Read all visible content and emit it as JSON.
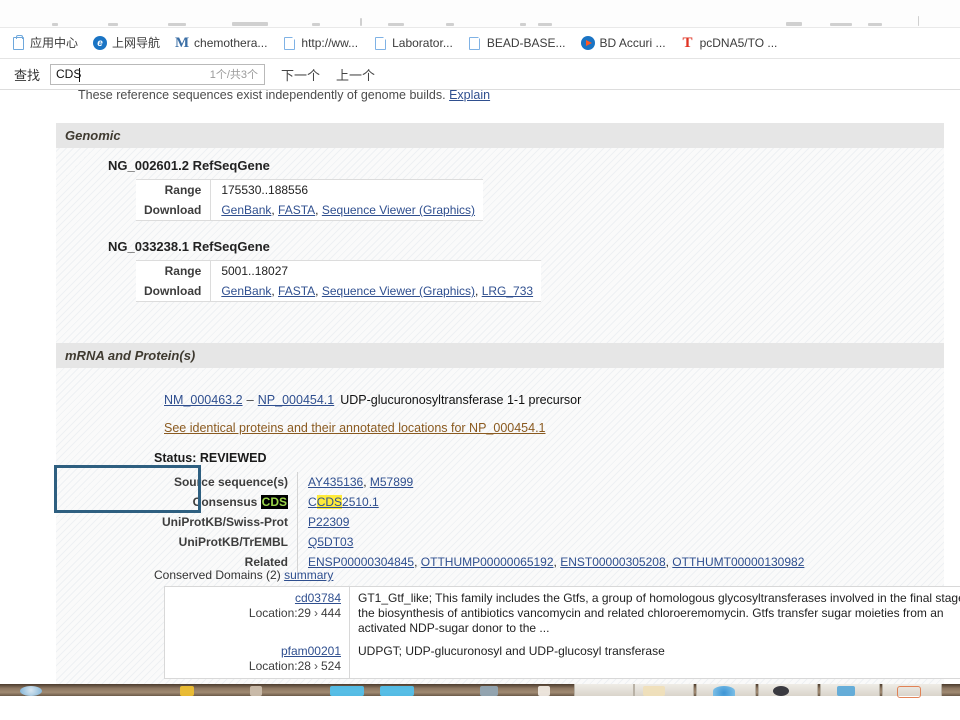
{
  "browser": {
    "bookmarks": [
      {
        "label": "应用中心",
        "icon": "app-center-icon",
        "icon_type": "app"
      },
      {
        "label": "上网导航",
        "icon": "navigation-icon",
        "icon_type": "circle-e"
      },
      {
        "label": "chemothera...",
        "icon": "mendeley-icon",
        "icon_type": "letter-m"
      },
      {
        "label": "http://ww...",
        "icon": "page-icon",
        "icon_type": "page"
      },
      {
        "label": "Laborator...",
        "icon": "page-icon",
        "icon_type": "page"
      },
      {
        "label": "BEAD-BASE...",
        "icon": "page-icon",
        "icon_type": "page"
      },
      {
        "label": "BD Accuri ...",
        "icon": "media-play-icon",
        "icon_type": "play"
      },
      {
        "label": "pcDNA5/TO ...",
        "icon": "thermo-icon",
        "icon_type": "letter-t"
      }
    ]
  },
  "find_bar": {
    "label": "查找",
    "query": "CDS",
    "placeholder": "",
    "match_count": "1个/共3个",
    "next_label": "下一个",
    "previous_label": "上一个"
  },
  "page": {
    "intro": {
      "text": "These reference sequences exist independently of genome builds.",
      "explain_link": "Explain"
    },
    "genomic": {
      "band_title": "Genomic",
      "records": [
        {
          "title": "NG_002601.2 RefSeqGene",
          "rows": [
            {
              "key": "Range",
              "value": "175530..188556",
              "links": []
            },
            {
              "key": "Download",
              "value": "",
              "links": [
                "GenBank",
                "FASTA",
                "Sequence Viewer (Graphics)"
              ]
            }
          ]
        },
        {
          "title": "NG_033238.1 RefSeqGene",
          "rows": [
            {
              "key": "Range",
              "value": "5001..18027",
              "links": []
            },
            {
              "key": "Download",
              "value": "",
              "links": [
                "GenBank",
                "FASTA",
                "Sequence Viewer (Graphics)",
                "LRG_733"
              ]
            }
          ]
        }
      ]
    },
    "mrna_protein": {
      "band_title": "mRNA and Protein(s)",
      "mrna_accession": "NM_000463.2",
      "separator": "–",
      "protein_accession": "NP_000454.1",
      "description": "UDP-glucuronosyltransferase 1-1 precursor",
      "identical_proteins_link": "See identical proteins and their annotated locations for NP_000454.1",
      "status": "Status: REVIEWED",
      "details": [
        {
          "key": "Source sequence(s)",
          "links": [
            "AY435136",
            "M57899"
          ],
          "separator": ", "
        },
        {
          "key": "Consensus CDS",
          "key_highlight": "CDS",
          "links": [
            "CCDS2510.1"
          ],
          "link_highlight": "CDS",
          "separator": ""
        },
        {
          "key": "UniProtKB/Swiss-Prot",
          "links": [
            "P22309"
          ],
          "separator": ""
        },
        {
          "key": "UniProtKB/TrEMBL",
          "links": [
            "Q5DT03"
          ],
          "separator": ""
        },
        {
          "key": "Related",
          "links": [
            "ENSP00000304845",
            "OTTHUMP00000065192",
            "ENST00000305208",
            "OTTHUMT00000130982"
          ],
          "separator": ", "
        }
      ],
      "conserved_domains": {
        "label": "Conserved Domains (2)",
        "summary_link": "summary",
        "rows": [
          {
            "accession": "cd03784",
            "location_label": "Location:",
            "location_start": "29",
            "arrow": "›",
            "location_end": "444",
            "description": "GT1_Gtf_like; This family includes the Gtfs, a group of homologous glycosyltransferases involved in the final stages of the biosynthesis of antibiotics vancomycin and related chloroeremomycin. Gtfs transfer sugar moieties from an activated NDP-sugar donor to the ..."
          },
          {
            "accession": "pfam00201",
            "location_label": "Location:",
            "location_start": "28",
            "arrow": "›",
            "location_end": "524",
            "description": "UDPGT; UDP-glucuronosyl and UDP-glucosyl transferase"
          }
        ]
      }
    }
  },
  "colors": {
    "link": "#2f4f8f",
    "visited_link": "#8a5a20",
    "band_background": "#e6e6e6",
    "highlight_box_border": "#2e5f80",
    "find_hit_yellow": "#ffeb3b",
    "find_hit_active_bg": "#000000",
    "find_hit_active_fg": "#9bd44a"
  }
}
